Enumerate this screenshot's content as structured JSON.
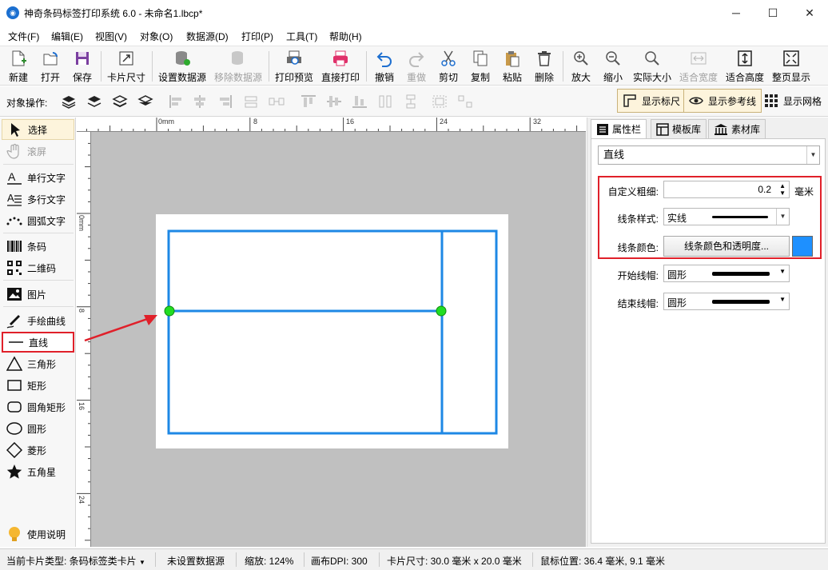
{
  "window": {
    "title": "神奇条码标签打印系统 6.0 - 未命名1.lbcp*",
    "controls": {
      "minimize": "─",
      "maximize": "☐",
      "close": "✕"
    }
  },
  "menu": [
    "文件(F)",
    "编辑(E)",
    "视图(V)",
    "对象(O)",
    "数据源(D)",
    "打印(P)",
    "工具(T)",
    "帮助(H)"
  ],
  "toolbar": {
    "new": "新建",
    "open": "打开",
    "save": "保存",
    "card_size": "卡片尺寸",
    "set_datasource": "设置数据源",
    "remove_datasource": "移除数据源",
    "print_preview": "打印预览",
    "direct_print": "直接打印",
    "undo": "撤销",
    "redo": "重做",
    "cut": "剪切",
    "copy": "复制",
    "paste": "粘贴",
    "delete": "删除",
    "zoom_in": "放大",
    "zoom_out": "缩小",
    "actual_size": "实际大小",
    "fit_width": "适合宽度",
    "fit_height": "适合高度",
    "full_page": "整页显示"
  },
  "objbar": {
    "label": "对象操作:",
    "show_ruler": "显示标尺",
    "show_guides": "显示参考线",
    "show_grid": "显示网格"
  },
  "tools": {
    "select": "选择",
    "scroll": "滚屏",
    "single_text": "单行文字",
    "multi_text": "多行文字",
    "arc_text": "圆弧文字",
    "barcode": "条码",
    "qrcode": "二维码",
    "image": "图片",
    "freehand": "手绘曲线",
    "line": "直线",
    "triangle": "三角形",
    "rectangle": "矩形",
    "rounded_rect": "圆角矩形",
    "circle": "圆形",
    "diamond": "菱形",
    "star": "五角星",
    "help": "使用说明"
  },
  "rulers": {
    "h_labels": [
      "0mm",
      "8",
      "16",
      "24",
      "32"
    ],
    "v_labels": [
      "0mm",
      "8",
      "16",
      "24"
    ]
  },
  "panel": {
    "tabs": [
      "属性栏",
      "模板库",
      "素材库"
    ],
    "object_type": "直线",
    "thickness_label": "自定义粗细:",
    "thickness_value": "0.2",
    "thickness_unit": "毫米",
    "line_style_label": "线条样式:",
    "line_style_value": "实线",
    "line_color_label": "线条颜色:",
    "line_color_button": "线条颜色和透明度...",
    "line_color": "#1e90ff",
    "start_cap_label": "开始线帽:",
    "start_cap_value": "圆形",
    "end_cap_label": "结束线帽:",
    "end_cap_value": "圆形"
  },
  "status": {
    "card_type": "当前卡片类型: 条码标签类卡片",
    "datasource": "未设置数据源",
    "zoom": "缩放: 124%",
    "dpi": "画布DPI: 300",
    "card_size": "卡片尺寸: 30.0 毫米 x 20.0 毫米",
    "mouse_pos": "鼠标位置: 36.4 毫米, 9.1 毫米"
  },
  "colors": {
    "line_blue": "#1e88e5",
    "handle_green": "#22dd22",
    "highlight_red": "#e0202a",
    "canvas_gray": "#c0c0c0"
  }
}
